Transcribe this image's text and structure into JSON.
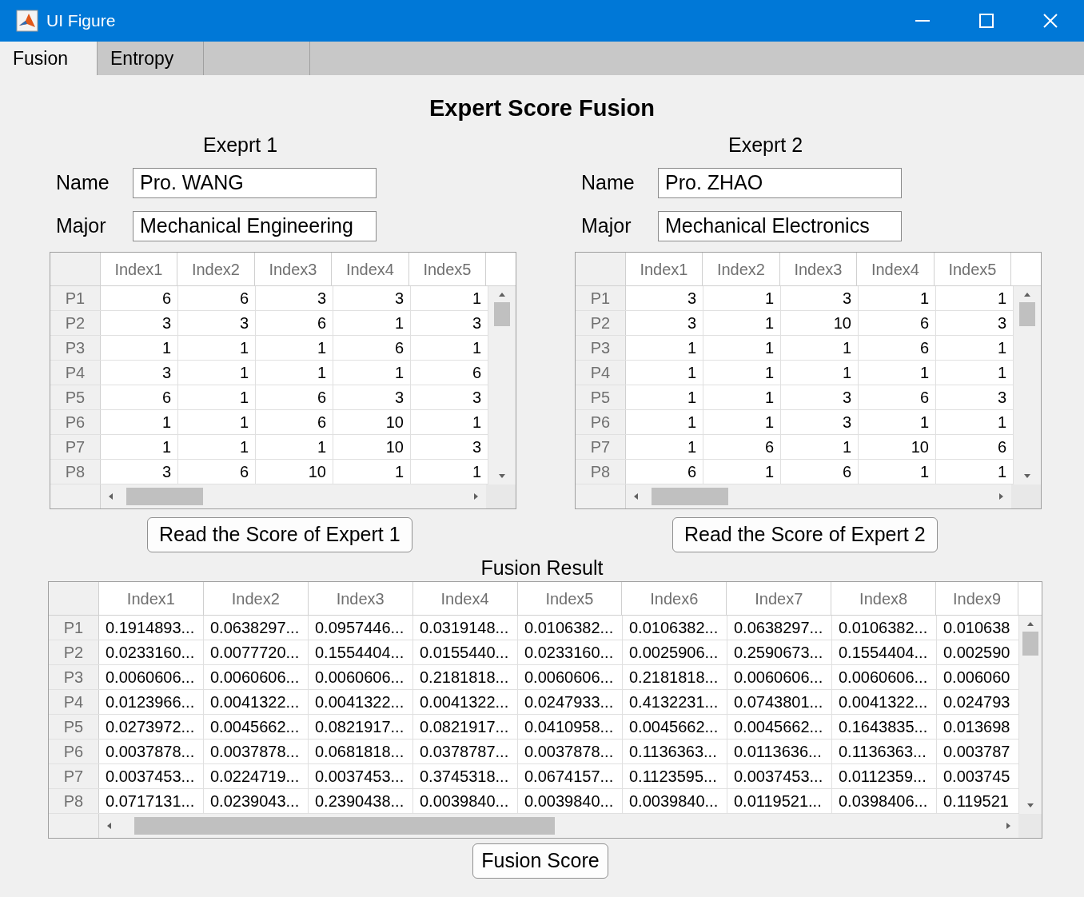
{
  "window": {
    "title": "UI Figure"
  },
  "tabs": [
    {
      "label": "Fusion",
      "selected": true
    },
    {
      "label": "Entropy",
      "selected": false
    },
    {
      "selected": false
    }
  ],
  "heading": "Expert Score Fusion",
  "experts": [
    {
      "title": "Exeprt 1",
      "name_label": "Name",
      "name": "Pro. WANG",
      "major_label": "Major",
      "major": "Mechanical Engineering",
      "button": "Read the Score of Expert 1",
      "table": {
        "columns": [
          "Index1",
          "Index2",
          "Index3",
          "Index4",
          "Index5"
        ],
        "rows": [
          {
            "label": "P1",
            "cells": [
              "6",
              "6",
              "3",
              "3",
              "1"
            ]
          },
          {
            "label": "P2",
            "cells": [
              "3",
              "3",
              "6",
              "1",
              "3"
            ]
          },
          {
            "label": "P3",
            "cells": [
              "1",
              "1",
              "1",
              "6",
              "1"
            ]
          },
          {
            "label": "P4",
            "cells": [
              "3",
              "1",
              "1",
              "1",
              "6"
            ]
          },
          {
            "label": "P5",
            "cells": [
              "6",
              "1",
              "6",
              "3",
              "3"
            ]
          },
          {
            "label": "P6",
            "cells": [
              "1",
              "1",
              "6",
              "10",
              "1"
            ]
          },
          {
            "label": "P7",
            "cells": [
              "1",
              "1",
              "1",
              "10",
              "3"
            ]
          },
          {
            "label": "P8",
            "cells": [
              "3",
              "6",
              "10",
              "1",
              "1"
            ]
          }
        ]
      }
    },
    {
      "title": "Exeprt 2",
      "name_label": "Name",
      "name": "Pro. ZHAO",
      "major_label": "Major",
      "major": "Mechanical Electronics",
      "button": "Read the Score of Expert 2",
      "table": {
        "columns": [
          "Index1",
          "Index2",
          "Index3",
          "Index4",
          "Index5"
        ],
        "rows": [
          {
            "label": "P1",
            "cells": [
              "3",
              "1",
              "3",
              "1",
              "1"
            ]
          },
          {
            "label": "P2",
            "cells": [
              "3",
              "1",
              "10",
              "6",
              "3"
            ]
          },
          {
            "label": "P3",
            "cells": [
              "1",
              "1",
              "1",
              "6",
              "1"
            ]
          },
          {
            "label": "P4",
            "cells": [
              "1",
              "1",
              "1",
              "1",
              "1"
            ]
          },
          {
            "label": "P5",
            "cells": [
              "1",
              "1",
              "3",
              "6",
              "3"
            ]
          },
          {
            "label": "P6",
            "cells": [
              "1",
              "1",
              "3",
              "1",
              "1"
            ]
          },
          {
            "label": "P7",
            "cells": [
              "1",
              "6",
              "1",
              "10",
              "6"
            ]
          },
          {
            "label": "P8",
            "cells": [
              "6",
              "1",
              "6",
              "1",
              "1"
            ]
          }
        ]
      }
    }
  ],
  "fusion": {
    "title": "Fusion Result",
    "button": "Fusion Score",
    "table": {
      "columns": [
        "Index1",
        "Index2",
        "Index3",
        "Index4",
        "Index5",
        "Index6",
        "Index7",
        "Index8",
        "Index9"
      ],
      "rows": [
        {
          "label": "P1",
          "cells": [
            "0.1914893...",
            "0.0638297...",
            "0.0957446...",
            "0.0319148...",
            "0.0106382...",
            "0.0106382...",
            "0.0638297...",
            "0.0106382...",
            "0.010638"
          ]
        },
        {
          "label": "P2",
          "cells": [
            "0.0233160...",
            "0.0077720...",
            "0.1554404...",
            "0.0155440...",
            "0.0233160...",
            "0.0025906...",
            "0.2590673...",
            "0.1554404...",
            "0.002590"
          ]
        },
        {
          "label": "P3",
          "cells": [
            "0.0060606...",
            "0.0060606...",
            "0.0060606...",
            "0.2181818...",
            "0.0060606...",
            "0.2181818...",
            "0.0060606...",
            "0.0060606...",
            "0.006060"
          ]
        },
        {
          "label": "P4",
          "cells": [
            "0.0123966...",
            "0.0041322...",
            "0.0041322...",
            "0.0041322...",
            "0.0247933...",
            "0.4132231...",
            "0.0743801...",
            "0.0041322...",
            "0.024793"
          ]
        },
        {
          "label": "P5",
          "cells": [
            "0.0273972...",
            "0.0045662...",
            "0.0821917...",
            "0.0821917...",
            "0.0410958...",
            "0.0045662...",
            "0.0045662...",
            "0.1643835...",
            "0.013698"
          ]
        },
        {
          "label": "P6",
          "cells": [
            "0.0037878...",
            "0.0037878...",
            "0.0681818...",
            "0.0378787...",
            "0.0037878...",
            "0.1136363...",
            "0.0113636...",
            "0.1136363...",
            "0.003787"
          ]
        },
        {
          "label": "P7",
          "cells": [
            "0.0037453...",
            "0.0224719...",
            "0.0037453...",
            "0.3745318...",
            "0.0674157...",
            "0.1123595...",
            "0.0037453...",
            "0.0112359...",
            "0.003745"
          ]
        },
        {
          "label": "P8",
          "cells": [
            "0.0717131...",
            "0.0239043...",
            "0.2390438...",
            "0.0039840...",
            "0.0039840...",
            "0.0039840...",
            "0.0119521...",
            "0.0398406...",
            "0.119521"
          ]
        }
      ]
    }
  }
}
